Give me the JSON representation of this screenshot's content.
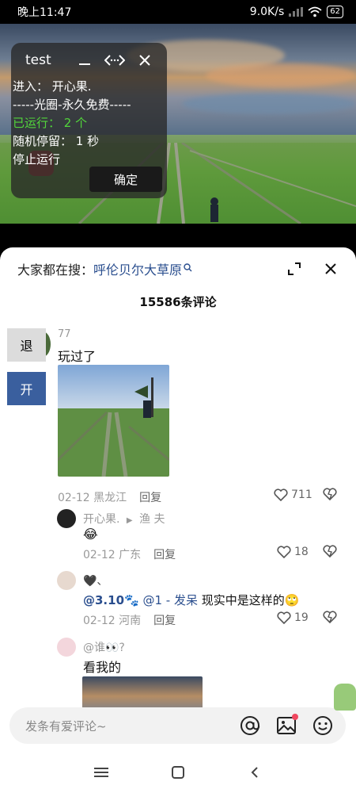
{
  "status_bar": {
    "time": "晚上11:47",
    "speed": "9.0K/s",
    "battery": "62"
  },
  "float_window": {
    "title": "test",
    "minimize_icon": "minimize-icon",
    "drag_icon": "drag-arrows-icon",
    "close_icon": "close-icon",
    "lines": [
      "进入：  开心果.",
      "-----光圈-永久免费-----",
      "已运行：  2 个",
      "随机停留：  1 秒",
      "停止运行"
    ],
    "confirm_label": "确定"
  },
  "sheet": {
    "search_lead": "大家都在搜：",
    "search_term": "呼伦贝尔大草原",
    "count_text": "15586条评论"
  },
  "side_buttons": {
    "exit": "退",
    "start": "开"
  },
  "comments": [
    {
      "name": "77",
      "text": "玩过了",
      "date": "02-12 黑龙江",
      "reply": "回复",
      "likes": "711"
    },
    {
      "name": "开心果.",
      "reply_to": "渔 夫",
      "emoji": "😂",
      "date": "02-12 广东",
      "reply": "回复",
      "likes": "18"
    },
    {
      "name": "🖤、",
      "mention1": "@3.10🐾",
      "mention2": "@1 - 发呆",
      "text": "现实中是这样的🙄",
      "date": "02-12 河南",
      "reply": "回复",
      "likes": "19"
    },
    {
      "name": "@谁👀?",
      "text": "看我的"
    }
  ],
  "input": {
    "placeholder": "发条有爱评论~"
  },
  "colors": {
    "accent_blue": "#2a4e8e",
    "green_text": "#52d63b",
    "start_button": "#3a5f9e",
    "red_dot": "#f04860"
  }
}
